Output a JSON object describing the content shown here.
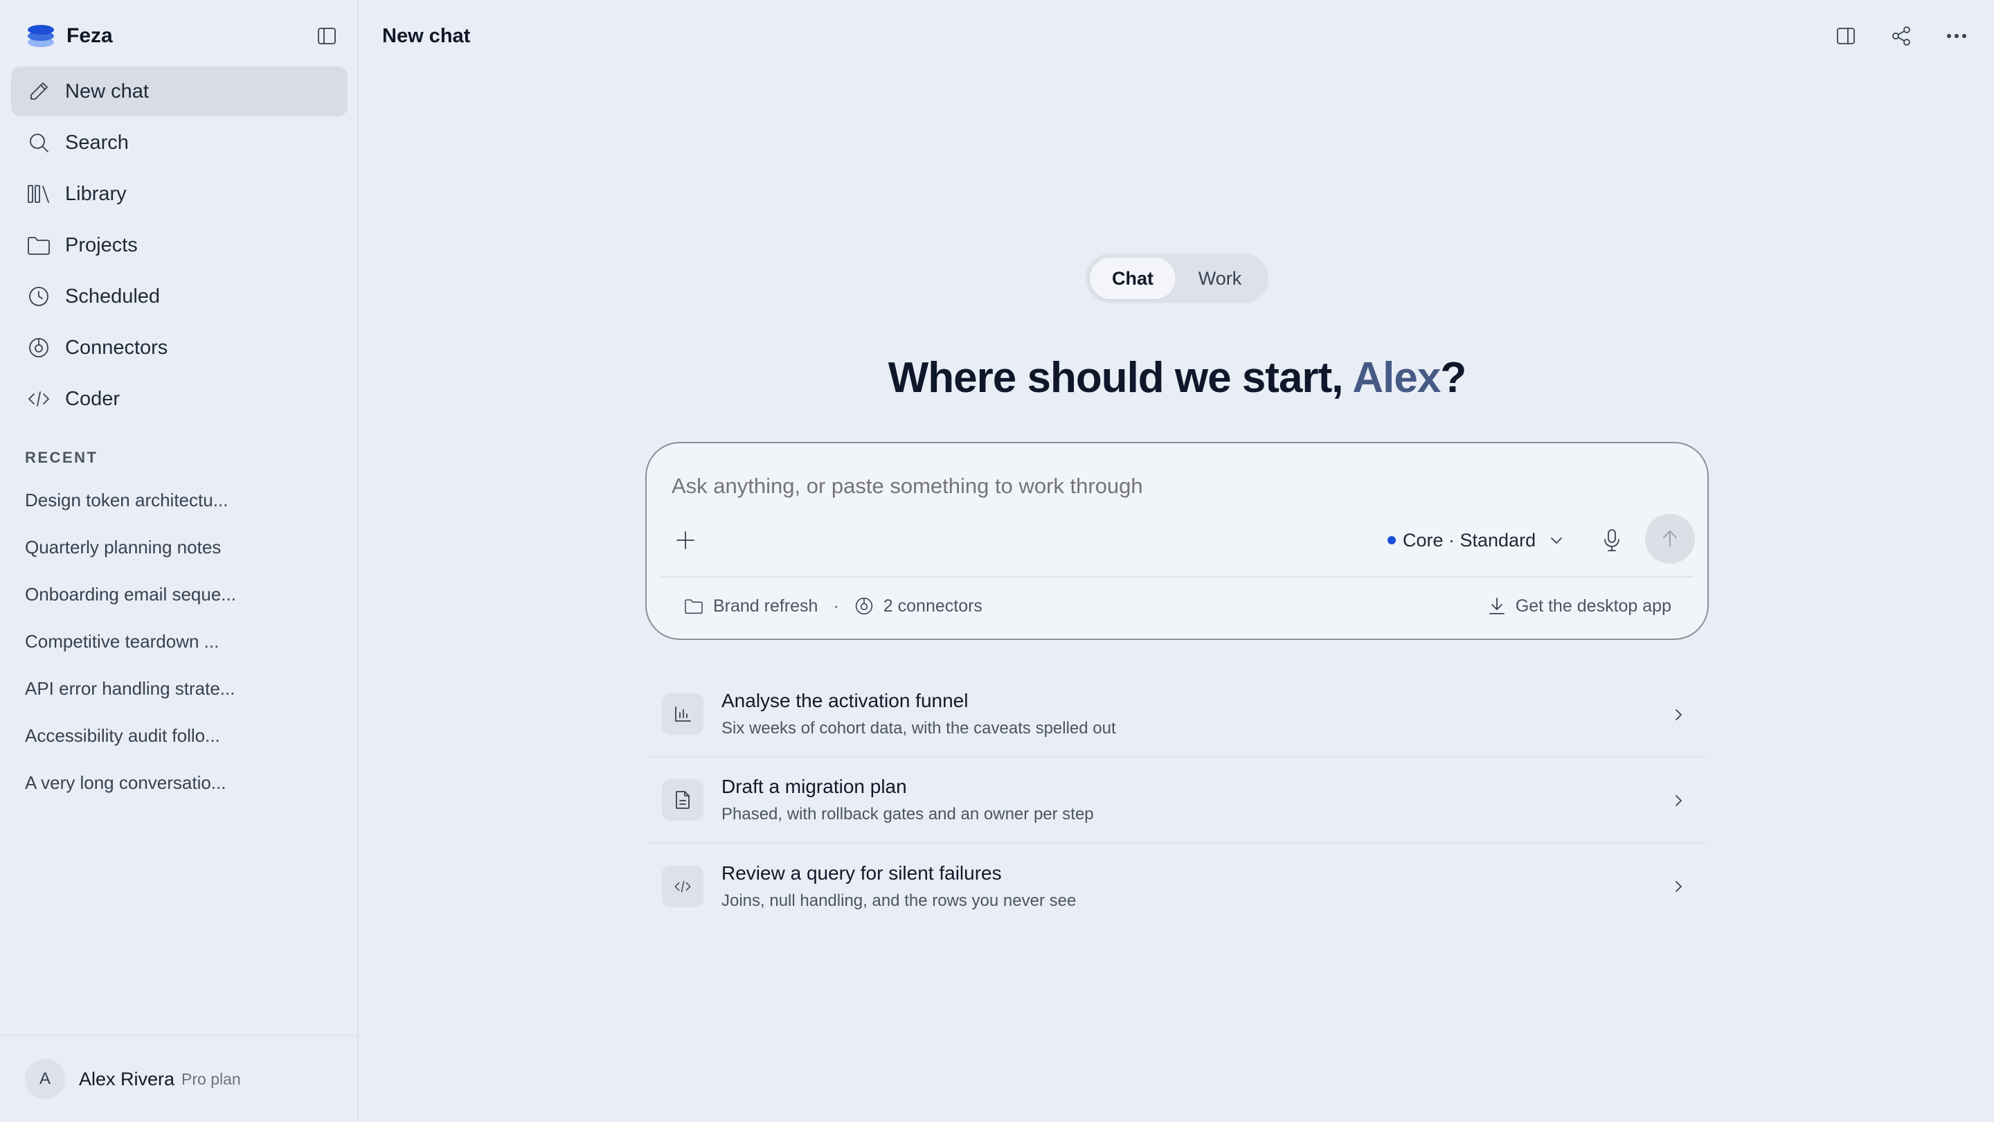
{
  "app": {
    "name": "Feza"
  },
  "sidebar": {
    "nav": [
      {
        "label": "New chat",
        "icon": "pencil-icon",
        "active": true
      },
      {
        "label": "Search",
        "icon": "search-icon"
      },
      {
        "label": "Library",
        "icon": "library-icon"
      },
      {
        "label": "Projects",
        "icon": "folder-icon"
      },
      {
        "label": "Scheduled",
        "icon": "clock-icon"
      },
      {
        "label": "Connectors",
        "icon": "connector-icon"
      },
      {
        "label": "Coder",
        "icon": "code-icon"
      }
    ],
    "recent_label": "RECENT",
    "recent": [
      "Design token architectu...",
      "Quarterly planning notes",
      "Onboarding email seque...",
      "Competitive teardown ...",
      "API error handling strate...",
      "Accessibility audit follo...",
      "A very long conversatio..."
    ],
    "user": {
      "initial": "A",
      "name": "Alex Rivera",
      "plan": "Pro plan"
    }
  },
  "header": {
    "title": "New chat"
  },
  "mode_toggle": {
    "active": "Chat",
    "inactive": "Work"
  },
  "headline": {
    "prefix": "Where should we start, ",
    "name": "Alex",
    "suffix": "?"
  },
  "composer": {
    "placeholder": "Ask anything, or paste something to work through",
    "model": "Core · Standard",
    "project": "Brand refresh",
    "separator": "·",
    "connectors": "2 connectors",
    "desktop_link": "Get the desktop app"
  },
  "suggestions": [
    {
      "icon": "bar-chart-icon",
      "title": "Analyse the activation funnel",
      "subtitle": "Six weeks of cohort data, with the caveats spelled out"
    },
    {
      "icon": "document-icon",
      "title": "Draft a migration plan",
      "subtitle": "Phased, with rollback gates and an owner per step"
    },
    {
      "icon": "code-icon",
      "title": "Review a query for silent failures",
      "subtitle": "Joins, null handling, and the rows you never see"
    }
  ],
  "colors": {
    "background": "#e9edf5",
    "accent_name": "#475a85",
    "brand_blue": "#1d4ed8"
  }
}
